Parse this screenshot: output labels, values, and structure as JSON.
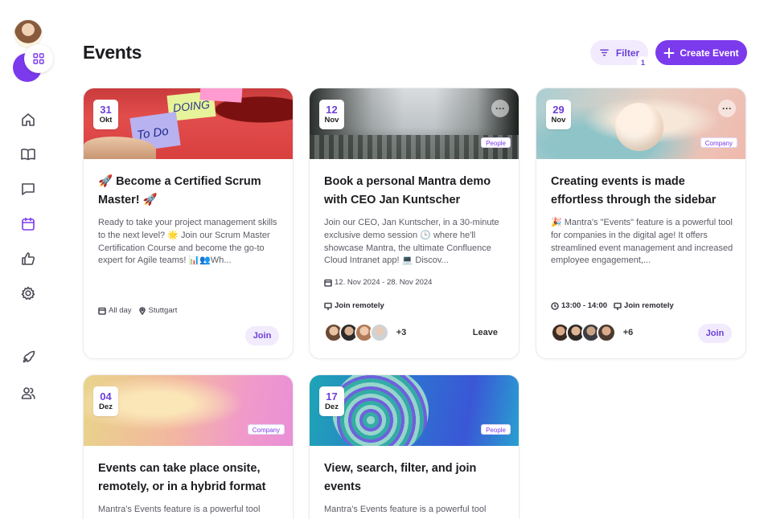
{
  "header": {
    "title": "Events",
    "filter_label": "Filter",
    "filter_count": "1",
    "create_label": "Create Event"
  },
  "sidebar": {
    "items": [
      {
        "name": "home-icon"
      },
      {
        "name": "book-icon"
      },
      {
        "name": "chat-icon"
      },
      {
        "name": "calendar-icon",
        "active": true
      },
      {
        "name": "thumbs-up-icon"
      },
      {
        "name": "gear-icon"
      },
      {
        "name": "rocket-icon"
      },
      {
        "name": "users-icon"
      }
    ]
  },
  "colors": {
    "accent": "#7c3aed",
    "accent_soft": "#f1ebfd"
  },
  "cards": [
    {
      "day": "31",
      "month": "Okt",
      "title": "🚀 Become a Certified Scrum Master! 🚀",
      "description": "Ready to take your project management skills to the next level? 🌟 Join our Scrum Master Certification Course and become the go-to expert for Agile teams! 📊👥Wh...",
      "meta_time": "All day",
      "meta_location": "Stuttgart",
      "action": "Join"
    },
    {
      "day": "12",
      "month": "Nov",
      "tag": "People",
      "more": "···",
      "title": "Book a personal Mantra demo with CEO Jan Kuntscher",
      "description": "Join our CEO, Jan Kuntscher, in a 30-minute exclusive demo session 🕒 where he'll showcase Mantra, the ultimate Confluence Cloud Intranet app! 💻 Discov...",
      "date_range": "12. Nov 2024 - 28. Nov 2024",
      "remote": "Join remotely",
      "more_attendees": "+3",
      "action": "Leave"
    },
    {
      "day": "29",
      "month": "Nov",
      "tag": "Company",
      "more": "···",
      "title": "Creating events is made effortless through the sidebar",
      "description": "🎉 Mantra's \"Events\" feature is a powerful tool for companies in the digital age! It offers streamlined event management and increased employee engagement,...",
      "time": "13:00 - 14:00",
      "remote": "Join remotely",
      "more_attendees": "+6",
      "action": "Join"
    },
    {
      "day": "04",
      "month": "Dez",
      "tag": "Company",
      "title": "Events can take place onsite, remotely, or in a hybrid format",
      "description": "Mantra's Events feature is a powerful tool"
    },
    {
      "day": "17",
      "month": "Dez",
      "tag": "People",
      "title": "View, search, filter, and join events",
      "description": "Mantra's Events feature is a powerful tool"
    }
  ]
}
